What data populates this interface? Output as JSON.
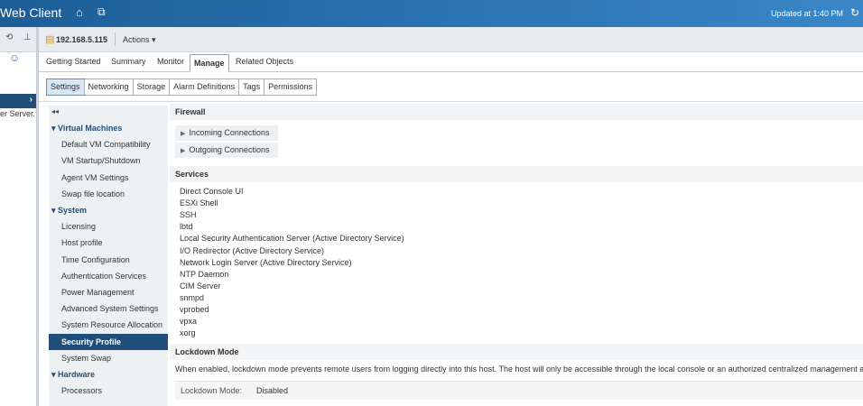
{
  "header": {
    "app_title": "Web Client",
    "updated_text": "Updated at 1:40 PM",
    "home_icon": "home-icon",
    "history_icon": "history-icon",
    "refresh_icon": "refresh-icon"
  },
  "left_panel": {
    "server_label": "er Server."
  },
  "object": {
    "host_name": "192.168.5.115",
    "actions_label": "Actions ▾"
  },
  "tabs": [
    "Getting Started",
    "Summary",
    "Monitor",
    "Manage",
    "Related Objects"
  ],
  "subtabs": [
    "Settings",
    "Networking",
    "Storage",
    "Alarm Definitions",
    "Tags",
    "Permissions"
  ],
  "nav": {
    "collapse": "◂◂",
    "items": [
      {
        "label": "▾ Virtual Machines",
        "type": "group"
      },
      {
        "label": "Default VM Compatibility",
        "type": "item"
      },
      {
        "label": "VM Startup/Shutdown",
        "type": "item"
      },
      {
        "label": "Agent VM Settings",
        "type": "item"
      },
      {
        "label": "Swap file location",
        "type": "item"
      },
      {
        "label": "▾ System",
        "type": "group"
      },
      {
        "label": "Licensing",
        "type": "item"
      },
      {
        "label": "Host profile",
        "type": "item"
      },
      {
        "label": "Time Configuration",
        "type": "item"
      },
      {
        "label": "Authentication Services",
        "type": "item"
      },
      {
        "label": "Power Management",
        "type": "item"
      },
      {
        "label": "Advanced System Settings",
        "type": "item"
      },
      {
        "label": "System Resource Allocation",
        "type": "item"
      },
      {
        "label": "Security Profile",
        "type": "selected"
      },
      {
        "label": "System Swap",
        "type": "item"
      },
      {
        "label": "▾ Hardware",
        "type": "group"
      },
      {
        "label": "Processors",
        "type": "item"
      }
    ]
  },
  "firewall": {
    "title": "Firewall",
    "incoming": "Incoming Connections",
    "outgoing": "Outgoing Connections"
  },
  "services": {
    "title": "Services",
    "items": [
      "Direct Console UI",
      "ESXi Shell",
      "SSH",
      "lbtd",
      "Local Security Authentication Server (Active Directory Service)",
      "I/O Redirector (Active Directory Service)",
      "Network Login Server (Active Directory Service)",
      "NTP Daemon",
      "CIM Server",
      "snmpd",
      "vprobed",
      "vpxa",
      "xorg"
    ]
  },
  "lockdown": {
    "title": "Lockdown Mode",
    "description": "When enabled, lockdown mode prevents remote users from logging directly into this host. The host will only be accessible through the local console or an authorized centralized management a",
    "label": "Lockdown Mode:",
    "value": "Disabled"
  }
}
